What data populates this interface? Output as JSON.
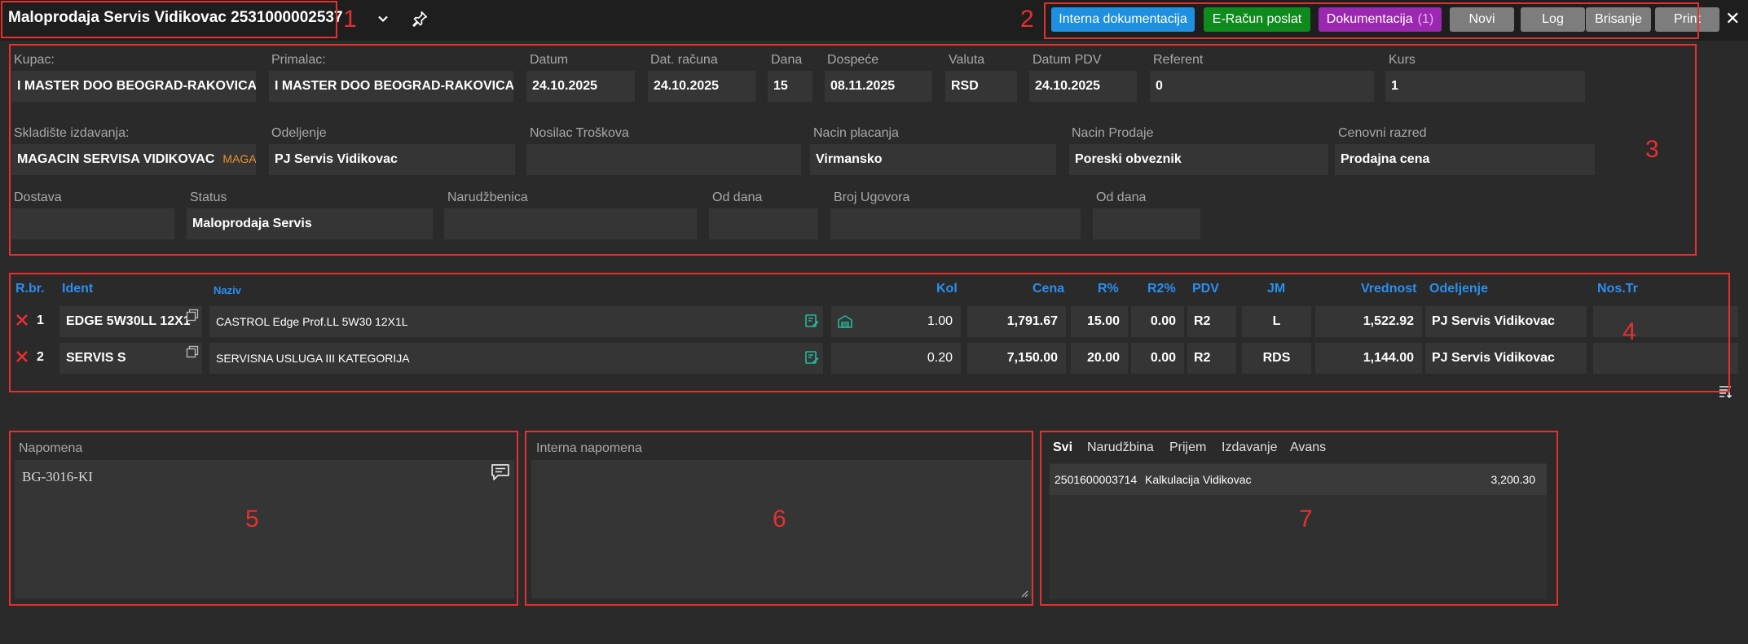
{
  "header": {
    "title": "Maloprodaja Servis Vidikovac 2531000002537",
    "buttons": {
      "interna": "Interna dokumentacija",
      "eracun": "E-Račun poslat",
      "dokumentacija": "Dokumentacija",
      "dokumentacija_count": "(1)",
      "novi": "Novi",
      "log": "Log",
      "brisanje": "Brisanje",
      "print": "Print"
    },
    "close": "✕"
  },
  "region_numbers": [
    "1",
    "2",
    "3",
    "4",
    "5",
    "6",
    "7"
  ],
  "form": {
    "kupac": {
      "label": "Kupac:",
      "value": "I MASTER DOO BEOGRAD-RAKOVICA"
    },
    "primalac": {
      "label": "Primalac:",
      "value": "I MASTER DOO BEOGRAD-RAKOVICA"
    },
    "datum": {
      "label": "Datum",
      "value": "24.10.2025"
    },
    "dat_racuna": {
      "label": "Dat. računa",
      "value": "24.10.2025"
    },
    "dana": {
      "label": "Dana",
      "value": "15"
    },
    "dospece": {
      "label": "Dospeće",
      "value": "08.11.2025"
    },
    "valuta": {
      "label": "Valuta",
      "value": "RSD"
    },
    "datum_pdv": {
      "label": "Datum PDV",
      "value": "24.10.2025"
    },
    "referent": {
      "label": "Referent",
      "value": "0"
    },
    "kurs": {
      "label": "Kurs",
      "value": "1"
    },
    "skladiste": {
      "label": "Skladište izdavanja:",
      "value": "MAGACIN SERVISA VIDIKOVAC",
      "tag": "MAGAC"
    },
    "odeljenje": {
      "label": "Odeljenje",
      "value": "PJ Servis Vidikovac"
    },
    "nosilac": {
      "label": "Nosilac Troškova",
      "value": ""
    },
    "nacin_placanja": {
      "label": "Nacin placanja",
      "value": "Virmansko"
    },
    "nacin_prodaje": {
      "label": "Nacin Prodaje",
      "value": "Poreski obveznik"
    },
    "cenovni_razred": {
      "label": "Cenovni razred",
      "value": "Prodajna cena"
    },
    "dostava": {
      "label": "Dostava",
      "value": ""
    },
    "status": {
      "label": "Status",
      "value": "Maloprodaja Servis"
    },
    "narudzbenica": {
      "label": "Narudžbenica",
      "value": ""
    },
    "od_dana": {
      "label": "Od dana",
      "value": ""
    },
    "broj_ugovora": {
      "label": "Broj Ugovora",
      "value": ""
    },
    "od_dana2": {
      "label": "Od dana",
      "value": ""
    }
  },
  "table": {
    "headers": {
      "rbr": "R.br.",
      "ident": "Ident",
      "naziv": "Naziv",
      "kol": "Kol",
      "cena": "Cena",
      "r": "R%",
      "r2": "R2%",
      "pdv": "PDV",
      "jm": "JM",
      "vrednost": "Vrednost",
      "odeljenje": "Odeljenje",
      "nostr": "Nos.Tr"
    },
    "rows": [
      {
        "rbr": "1",
        "ident": "EDGE 5W30LL 12X1",
        "naziv": "CASTROL Edge Prof.LL 5W30 12X1L",
        "kol": "1.00",
        "cena": "1,791.67",
        "r": "15.00",
        "r2": "0.00",
        "pdv": "R2",
        "jm": "L",
        "vrednost": "1,522.92",
        "odeljenje": "PJ Servis Vidikovac",
        "nostr": ""
      },
      {
        "rbr": "2",
        "ident": "SERVIS S",
        "naziv": "SERVISNA USLUGA III KATEGORIJA",
        "kol": "0.20",
        "cena": "7,150.00",
        "r": "20.00",
        "r2": "0.00",
        "pdv": "R2",
        "jm": "RDS",
        "vrednost": "1,144.00",
        "odeljenje": "PJ Servis Vidikovac",
        "nostr": ""
      }
    ]
  },
  "notes": {
    "napomena_label": "Napomena",
    "napomena_value": "BG-3016-KI",
    "interna_label": "Interna napomena",
    "interna_value": ""
  },
  "links": {
    "tabs": [
      "Svi",
      "Narudžbina",
      "Prijem",
      "Izdavanje",
      "Avans"
    ],
    "active_tab": "Svi",
    "items": [
      {
        "number": "2501600003714",
        "name": "Kalkulacija Vidikovac",
        "amount": "3,200.30"
      }
    ]
  },
  "colors": {
    "accent_blue": "#1f8fe0",
    "accent_green": "#0f8a1c",
    "accent_purple": "#9c27b0",
    "delete_red": "#e53030",
    "icon_teal": "#26b89a"
  }
}
